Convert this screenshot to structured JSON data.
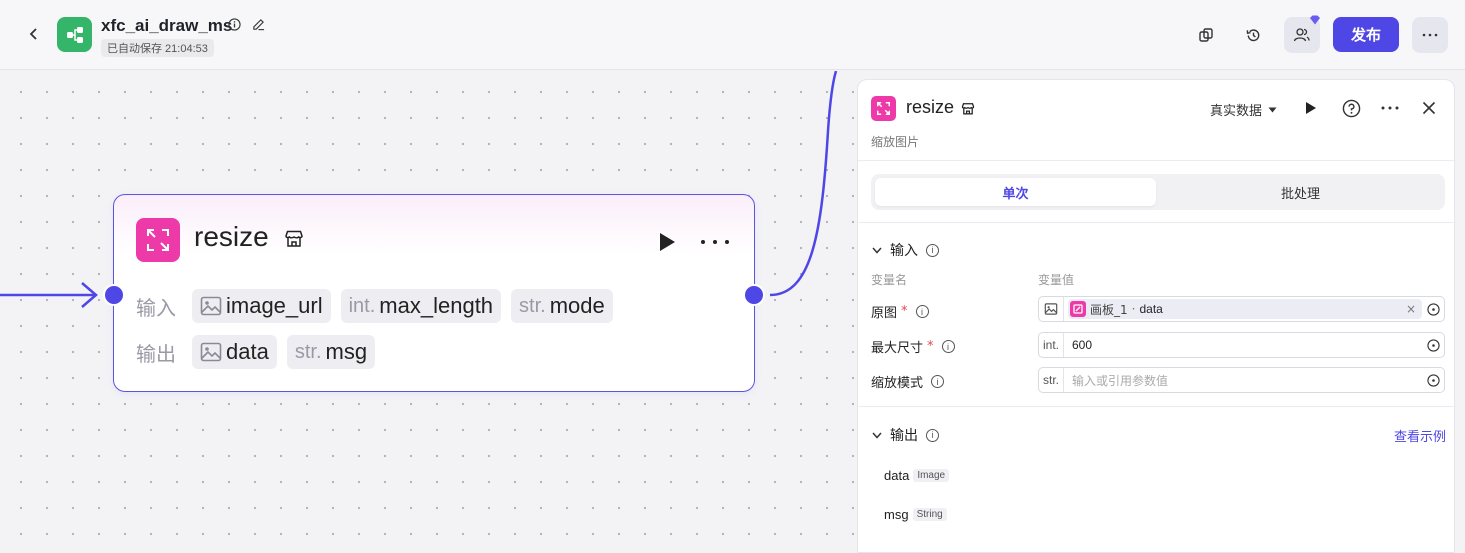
{
  "header": {
    "back_icon": "chevron-left-icon",
    "app_icon": "workflow-icon",
    "app_title": "xfc_ai_draw_ms",
    "autosave": "已自动保存 21:04:53",
    "publish_label": "发布",
    "accent_color": "#4e46e5"
  },
  "node": {
    "title": "resize",
    "icon": "resize-icon",
    "input_label": "输入",
    "output_label": "输出",
    "inputs": [
      {
        "type": "",
        "name": "image_url"
      },
      {
        "type": "int.",
        "name": "max_length"
      },
      {
        "type": "str.",
        "name": "mode"
      }
    ],
    "outputs": [
      {
        "type": "",
        "name": "data"
      },
      {
        "type": "str.",
        "name": "msg"
      }
    ]
  },
  "panel": {
    "title": "resize",
    "subtitle": "缩放图片",
    "data_mode": "真实数据",
    "tabs": {
      "single": "单次",
      "batch": "批处理"
    },
    "input_section": "输入",
    "col_name": "变量名",
    "col_value": "变量值",
    "fields": [
      {
        "label": "原图",
        "required": true,
        "prefix": "",
        "ref_node": "画板_1",
        "ref_sep": " · ",
        "ref_var": "data",
        "value": "",
        "placeholder": ""
      },
      {
        "label": "最大尺寸",
        "required": true,
        "prefix": "int.",
        "value": "600",
        "placeholder": ""
      },
      {
        "label": "缩放模式",
        "required": false,
        "prefix": "str.",
        "value": "",
        "placeholder": "输入或引用参数值"
      }
    ],
    "output_section": "输出",
    "view_example": "查看示例",
    "outputs": [
      {
        "name": "data",
        "type": "Image"
      },
      {
        "name": "msg",
        "type": "String"
      }
    ]
  }
}
